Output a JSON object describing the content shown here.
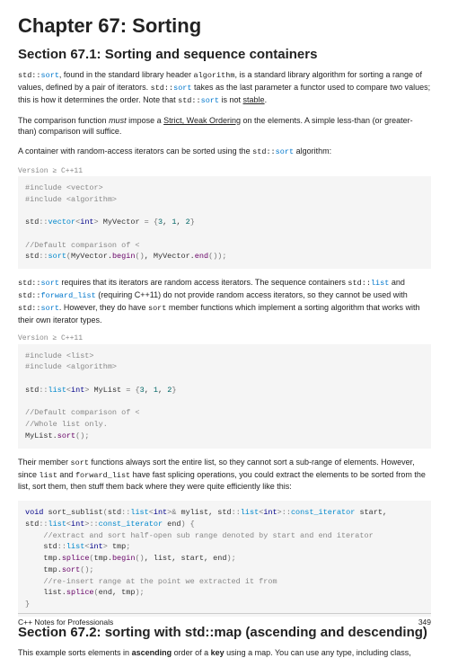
{
  "chapter": {
    "title": "Chapter 67: Sorting"
  },
  "section1": {
    "title": "Section 67.1: Sorting and sequence containers",
    "p1a": "std::",
    "p1b": "sort",
    "p1c": ", found in the standard library header ",
    "p1d": "algorithm",
    "p1e": ", is a standard library algorithm for sorting a range of values, defined by a pair of iterators. ",
    "p1f": "std::",
    "p1g": "sort",
    "p1h": " takes as the last parameter a functor used to compare two values; this is how it determines the order. Note that ",
    "p1i": "std::",
    "p1j": "sort",
    "p1k": " is not ",
    "p1l": "stable",
    "p1m": ".",
    "p2a": "The comparison function ",
    "p2b": "must",
    "p2c": " impose a ",
    "p2d": "Strict, Weak Ordering",
    "p2e": " on the elements. A simple less-than (or greater-than) comparison will suffice.",
    "p3a": "A container with random-access iterators can be sorted using the ",
    "p3b": "std::",
    "p3c": "sort",
    "p3d": " algorithm:",
    "ver1": "Version ≥ C++11",
    "p4a": "std::",
    "p4b": "sort",
    "p4c": " requires that its iterators are random access iterators. The sequence containers ",
    "p4d": "std::",
    "p4e": "list",
    "p4f": " and ",
    "p4g": "std::",
    "p4h": "forward_list",
    "p4i": " (requiring C++11) do not provide random access iterators, so they cannot be used with ",
    "p4j": "std::",
    "p4k": "sort",
    "p4l": ". However, they do have ",
    "p4m": "sort",
    "p4n": " member functions which implement a sorting algorithm that works with their own iterator types.",
    "ver2": "Version ≥ C++11",
    "p5a": "Their member ",
    "p5b": "sort",
    "p5c": " functions always sort the entire list, so they cannot sort a sub-range of elements. However, since ",
    "p5d": "list",
    "p5e": " and ",
    "p5f": "forward_list",
    "p5g": " have fast splicing operations, you could extract the elements to be sorted from the list, sort them, then stuff them back where they were quite efficiently like this:"
  },
  "section2": {
    "title": "Section 67.2: sorting with std::map (ascending and descending)",
    "p1a": "This example sorts elements in ",
    "p1b": "ascending",
    "p1c": " order of a ",
    "p1d": "key",
    "p1e": " using a map. You can use any type, including class,"
  },
  "footer": {
    "left": "C++ Notes for Professionals",
    "right": "349"
  }
}
